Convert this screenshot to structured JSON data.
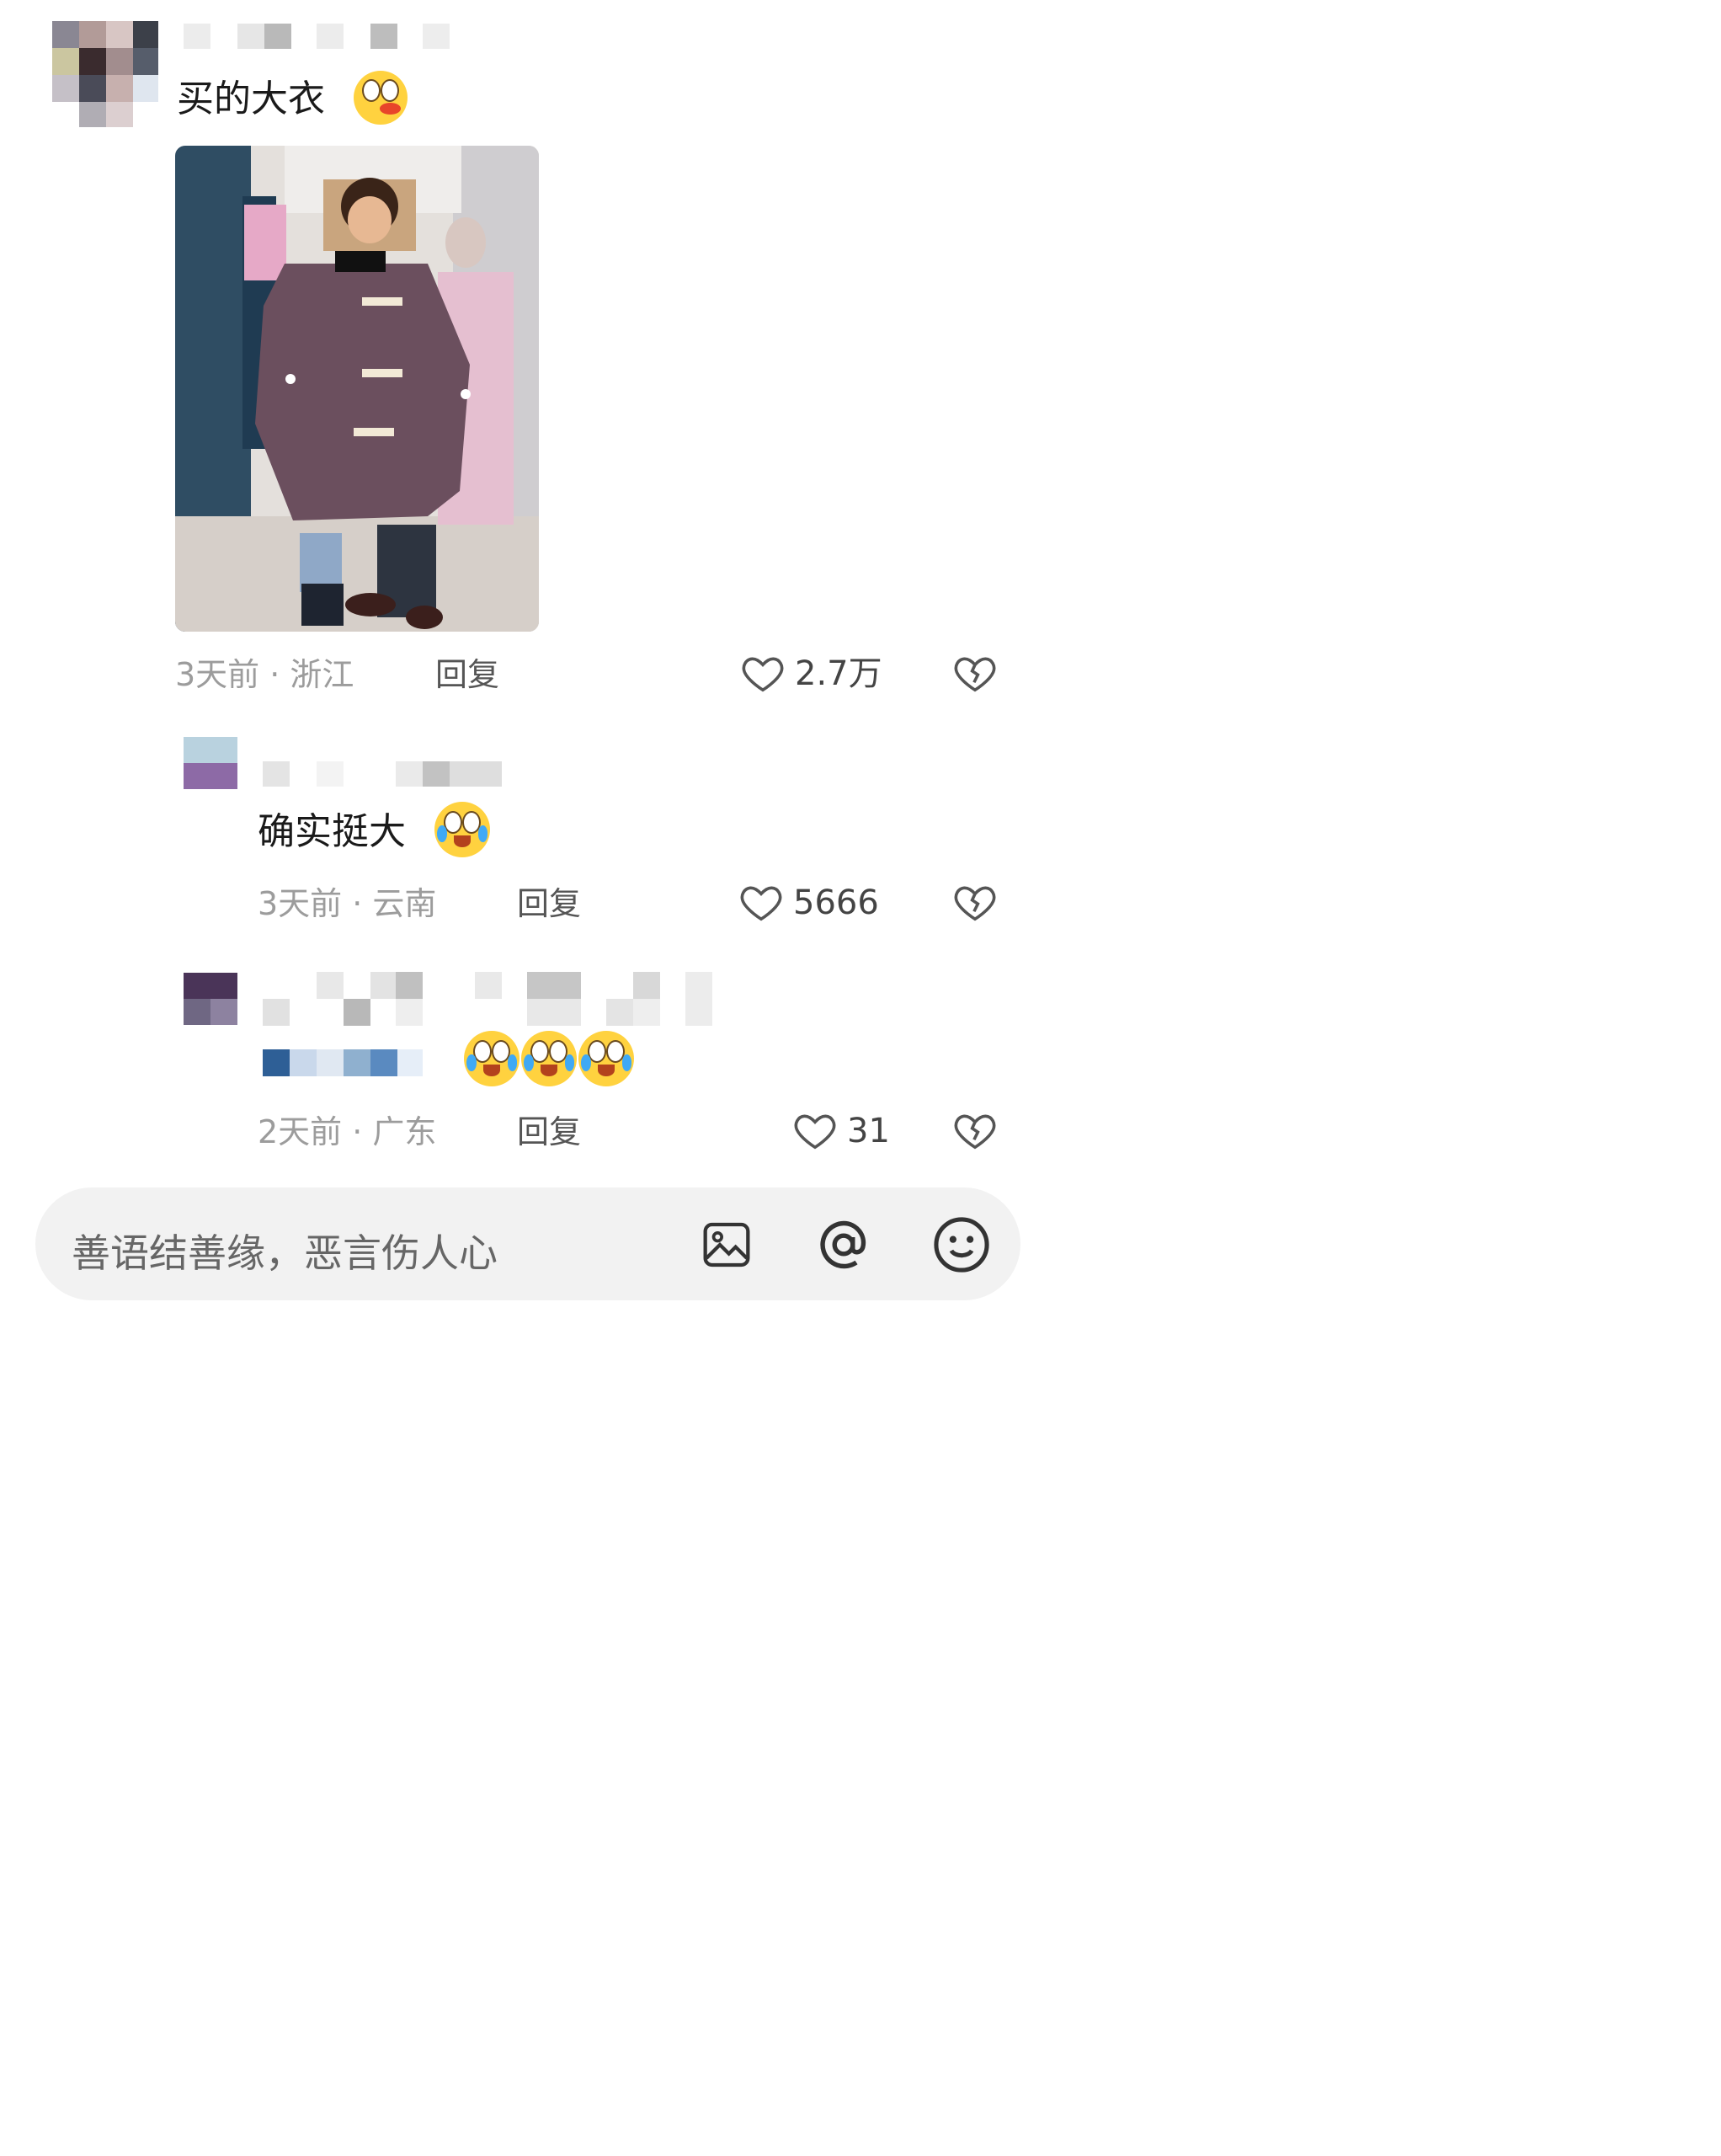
{
  "comments": [
    {
      "text": "买的大衣",
      "time_location": "3天前 · 浙江",
      "reply_label": "回复",
      "likes": "2.7万"
    },
    {
      "text": "确实挺大",
      "time_location": "3天前 · 云南",
      "reply_label": "回复",
      "likes": "5666"
    },
    {
      "text": "",
      "time_location": "2天前 · 广东",
      "reply_label": "回复",
      "likes": "31"
    }
  ],
  "input": {
    "placeholder": "善语结善缘，恶言伤人心"
  },
  "icons": {
    "like": "heart-outline-icon",
    "dislike": "broken-heart-icon",
    "image": "image-icon",
    "mention": "at-icon",
    "emoji": "smiley-icon"
  },
  "colors": {
    "meta_text": "#9c9c9c",
    "input_bg": "#f2f2f2",
    "coat": "#6b4f5e"
  }
}
